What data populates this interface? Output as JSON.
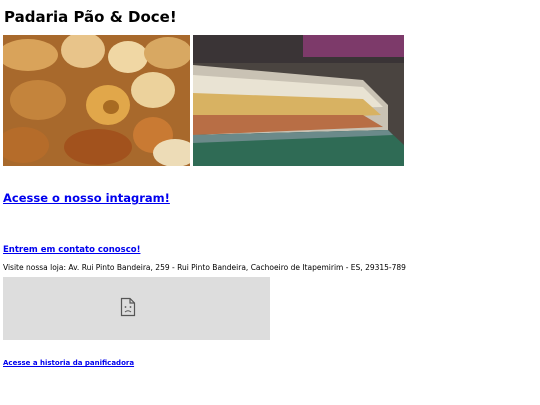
{
  "header": {
    "title": "Padaria Pão & Doce!"
  },
  "images": [
    {
      "name": "bread-photo"
    },
    {
      "name": "bakery-counter-photo"
    }
  ],
  "links": {
    "instagram": "Acesse o nosso intagram!",
    "contact": "Entrem em contato conosco!",
    "history": "Acesse a historia da panificadora"
  },
  "address": {
    "text": "Visite nossa loja: Av. Rui Pinto Bandeira, 259 - Rui Pinto Bandeira, Cachoeiro de Itapemirim - ES, 29315-789"
  },
  "map_embed": {
    "state": "broken",
    "icon": "broken-page-icon"
  }
}
